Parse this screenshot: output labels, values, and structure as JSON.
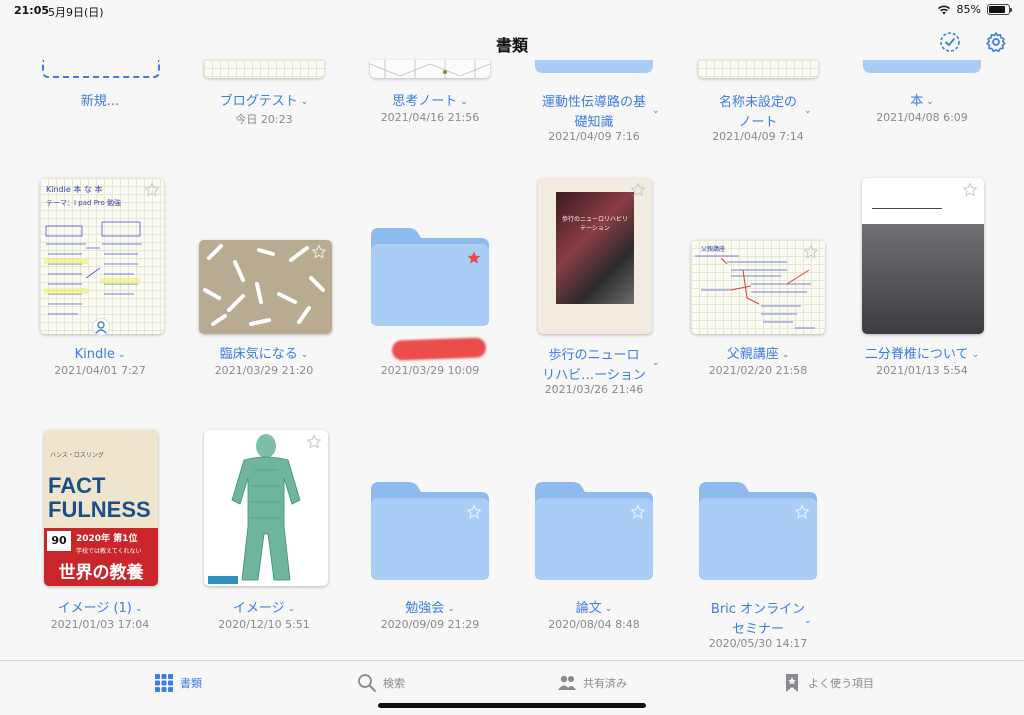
{
  "status_bar": {
    "time": "21:05",
    "date": "5月9日(日)",
    "battery": "85%",
    "battery_level": 0.85
  },
  "nav": {
    "title": "書類"
  },
  "top_row": [
    {
      "label": "新規...",
      "date": ""
    },
    {
      "label": "ブログテスト",
      "date": "今日 20:23"
    },
    {
      "label": "思考ノート",
      "date": "2021/04/16 21:56"
    },
    {
      "label": "運動性伝導路の基礎知識",
      "label_line1": "運動性伝導路の基",
      "label_line2": "礎知識",
      "date": "2021/04/09 7:16"
    },
    {
      "label": "名称未設定のノート",
      "label_line1": "名称未設定の",
      "label_line2": "ノート",
      "date": "2021/04/09 7:14"
    },
    {
      "label": "本",
      "date": "2021/04/08 6:09"
    }
  ],
  "middle_row": [
    {
      "label": "Kindle",
      "date": "2021/04/01 7:27"
    },
    {
      "label": "臨床気になる",
      "date": "2021/03/29 21:20"
    },
    {
      "label": "",
      "date": "2021/03/29 10:09"
    },
    {
      "label": "歩行のニューロリハビ…ーション",
      "label_line1": "歩行のニューロ",
      "label_line2": "リハビ…ーション",
      "date": "2021/03/26 21:46"
    },
    {
      "label": "父親講座",
      "date": "2021/02/20 21:58"
    },
    {
      "label": "二分脊椎について",
      "date": "2021/01/13 5:54"
    }
  ],
  "bottom_row": [
    {
      "label": "イメージ (1)",
      "date": "2021/01/03 17:04"
    },
    {
      "label": "イメージ",
      "date": "2020/12/10 5:51"
    },
    {
      "label": "勉強会",
      "date": "2020/09/09 21:29"
    },
    {
      "label": "論文",
      "date": "2020/08/04 8:48"
    },
    {
      "label": "Bric オンラインセミナー",
      "label_line1": "Bric オンライン",
      "label_line2": "セミナー",
      "date": "2020/05/30 14:17"
    }
  ],
  "thumb_text": {
    "kindle_line1": "Kindle 本 な 本",
    "kindle_line2": "テーマ：I pad Pro 勉強",
    "fact1": "FACT",
    "fact2": "FULNESS",
    "fact_author": "ハンス・ロスリング",
    "fact_pct": "90",
    "fact_rank": "2020年 第1位",
    "fact_sub": "学校では教えてくれない",
    "fact_title": "世界の教養",
    "walk_pub": "歩行のニューロリハビリテーション",
    "father_title": "父親講座"
  },
  "tabs": [
    {
      "label": "書類",
      "icon": "grid-icon",
      "active": true
    },
    {
      "label": "検索",
      "icon": "search-icon",
      "active": false
    },
    {
      "label": "共有済み",
      "icon": "shared-people-icon",
      "active": false
    },
    {
      "label": "よく使う項目",
      "icon": "bookmark-icon",
      "active": false
    }
  ],
  "colors": {
    "accent": "#3d7ce0",
    "folder": "#a9cdf5",
    "folder_back": "#8dbbee",
    "favorite_star": "#e84a4a",
    "date_gray": "#8a8a8e"
  }
}
